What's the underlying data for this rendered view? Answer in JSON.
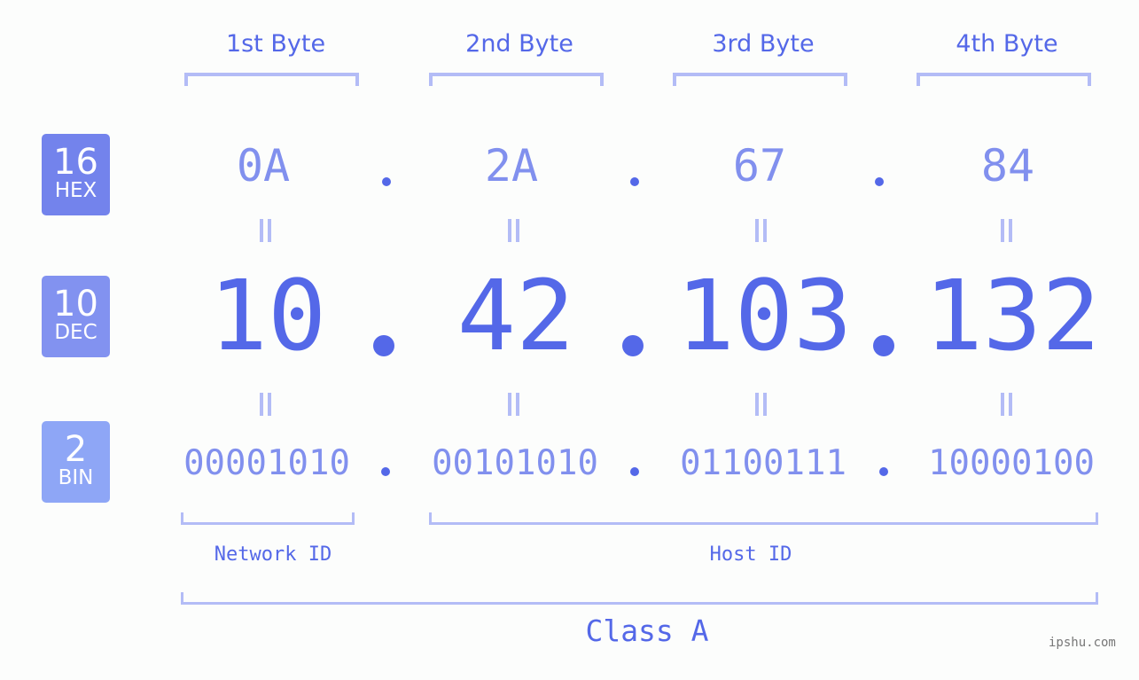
{
  "headers": [
    "1st Byte",
    "2nd Byte",
    "3rd Byte",
    "4th Byte"
  ],
  "badges": {
    "hex": {
      "num": "16",
      "label": "HEX",
      "color": "#7383ec"
    },
    "dec": {
      "num": "10",
      "label": "DEC",
      "color": "#8292f0"
    },
    "bin": {
      "num": "2",
      "label": "BIN",
      "color": "#8ea6f6"
    }
  },
  "hex": [
    "0A",
    "2A",
    "67",
    "84"
  ],
  "dec": [
    "10",
    "42",
    "103",
    "132"
  ],
  "bin": [
    "00001010",
    "00101010",
    "01100111",
    "10000100"
  ],
  "separator": ".",
  "network_label": "Network ID",
  "host_label": "Host ID",
  "class_label": "Class A",
  "watermark": "ipshu.com",
  "colors": {
    "accent": "#5468e8",
    "light": "#8190ee",
    "bracket": "#b3bcf6"
  }
}
